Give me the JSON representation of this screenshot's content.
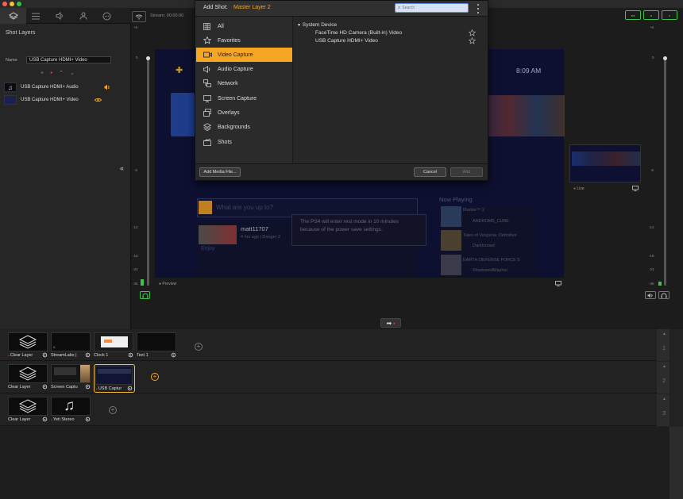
{
  "titlebar": {},
  "left_tabs": [
    "shot-layers-icon",
    "list-icon",
    "audio-icon",
    "person-icon",
    "more-icon"
  ],
  "shot_layers": {
    "title": "Shot Layers",
    "name_label": "Name",
    "name_value": "USB Capture HDMI+ Video",
    "layers": [
      {
        "label": "USB Capture HDMI+ Audio",
        "icon": "speaker-icon"
      },
      {
        "label": "USB Capture HDMI+ Video",
        "icon": "eye-icon"
      }
    ]
  },
  "stream": {
    "label": "Stream: 00:00:00"
  },
  "preview": {
    "preview_label": "Preview",
    "live_label": "Live",
    "clock": "8:09 AM",
    "post_placeholder": "What are you up to?",
    "notice": "The PS4 will enter rest mode in 10 minutes because of the power save settings.",
    "username": "matt11707",
    "subline": "4 hrs ago | Danger 2",
    "enjoy": "Enjoy",
    "now_playing": "Now Playing",
    "np_items": [
      {
        "title": "Marble™ 2",
        "sub": "ANDROM5_CUBE"
      },
      {
        "title": "Tales of Vesperia: Definitive",
        "sub": "DarkIcrowd"
      },
      {
        "title": "EARTH DEFENSE FORCE 5",
        "sub": "ShadowedMayhel"
      }
    ],
    "left_scale": [
      "+6",
      "0",
      "-6",
      "-12",
      "-18",
      "-24",
      "-36"
    ],
    "right_scale": [
      "+6",
      "0",
      "-6",
      "-12",
      "-18",
      "-24",
      "-36"
    ]
  },
  "dialog": {
    "title": "Add Shot:",
    "layer": "Master Layer 2",
    "search_placeholder": "Search",
    "categories": [
      {
        "label": "All",
        "icon": "grid-icon"
      },
      {
        "label": "Favorites",
        "icon": "star-icon"
      },
      {
        "label": "Video Capture",
        "icon": "camera-icon",
        "active": true
      },
      {
        "label": "Audio Capture",
        "icon": "speaker-icon"
      },
      {
        "label": "Network",
        "icon": "network-icon"
      },
      {
        "label": "Screen Capture",
        "icon": "screen-icon"
      },
      {
        "label": "Overlays",
        "icon": "overlay-icon"
      },
      {
        "label": "Backgrounds",
        "icon": "layers-icon"
      },
      {
        "label": "Shots",
        "icon": "film-icon"
      }
    ],
    "group": "System Device",
    "devices": [
      "FaceTime HD Camera (Built-in) Video",
      "USB Capture HDMI+ Video"
    ],
    "add_media": "Add Media File...",
    "cancel": "Cancel",
    "add": "Add"
  },
  "scenes": {
    "rows": [
      {
        "num": "1",
        "shots": [
          "Clear Layer",
          "StreamLabs |",
          "Clock 1",
          "Text 1"
        ]
      },
      {
        "num": "2",
        "shots": [
          "Clear Layer",
          "Screen Captu",
          "USB Captur"
        ]
      },
      {
        "num": "3",
        "shots": [
          "Clear Layer",
          "Yeti Stereo"
        ]
      }
    ]
  },
  "colors": {
    "accent": "#f5a623",
    "live": "#e0493a",
    "green": "#3ec24a"
  }
}
